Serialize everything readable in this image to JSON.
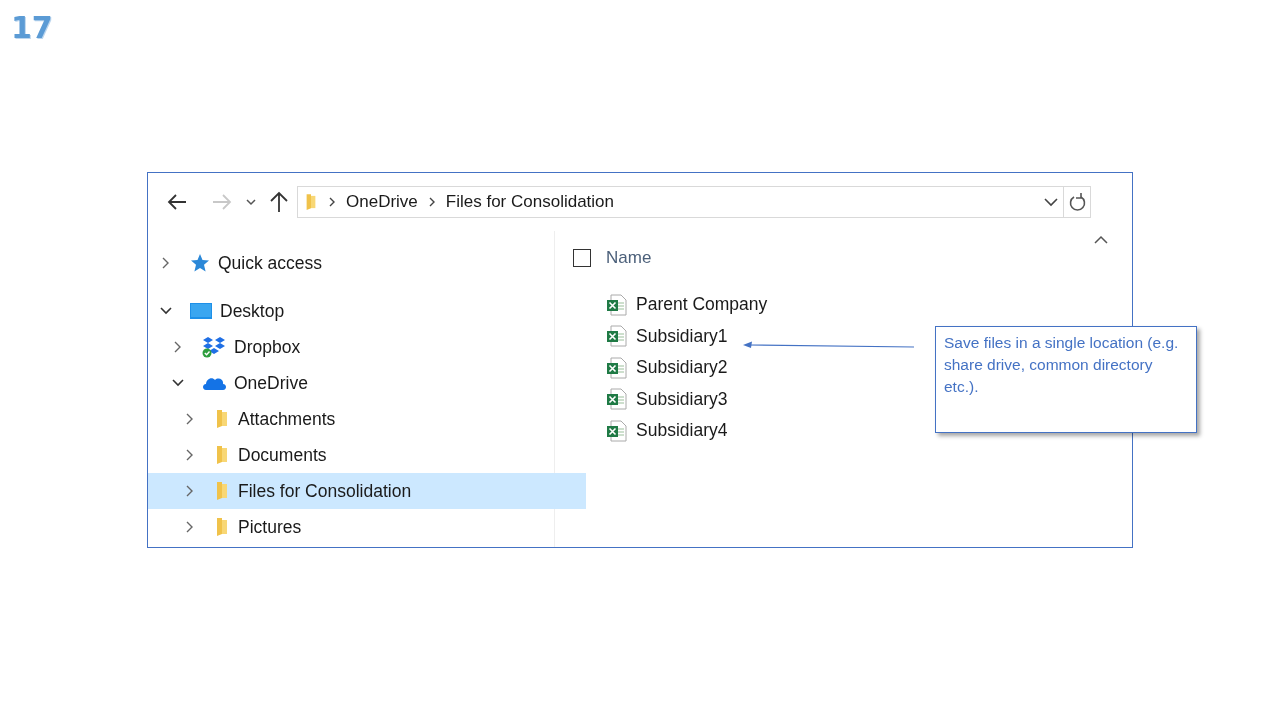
{
  "slide_number": "17",
  "address_bar": {
    "breadcrumb": [
      "OneDrive",
      "Files for Consolidation"
    ]
  },
  "navigation": [
    {
      "label": "Quick access",
      "kind": "star",
      "expanded": false,
      "selected": false
    },
    {
      "label": "Desktop",
      "kind": "desktop",
      "expanded": true,
      "selected": false,
      "children": [
        {
          "label": "Dropbox",
          "kind": "dropbox",
          "expanded": false,
          "selected": false
        },
        {
          "label": "OneDrive",
          "kind": "cloud",
          "expanded": true,
          "selected": false,
          "children": [
            {
              "label": "Attachments",
              "kind": "folder",
              "expanded": false,
              "selected": false
            },
            {
              "label": "Documents",
              "kind": "folder",
              "expanded": false,
              "selected": false
            },
            {
              "label": "Files for Consolidation",
              "kind": "folder",
              "expanded": false,
              "selected": true
            },
            {
              "label": "Pictures",
              "kind": "folder",
              "expanded": false,
              "selected": false
            }
          ]
        }
      ]
    }
  ],
  "file_list": {
    "column_header": "Name",
    "header_checked": false,
    "files": [
      {
        "name": "Parent Company"
      },
      {
        "name": "Subsidiary1"
      },
      {
        "name": "Subsidiary2"
      },
      {
        "name": "Subsidiary3"
      },
      {
        "name": "Subsidiary4"
      }
    ]
  },
  "callout": {
    "text": "Save files in a single location (e.g. share drive, common directory etc.)."
  }
}
